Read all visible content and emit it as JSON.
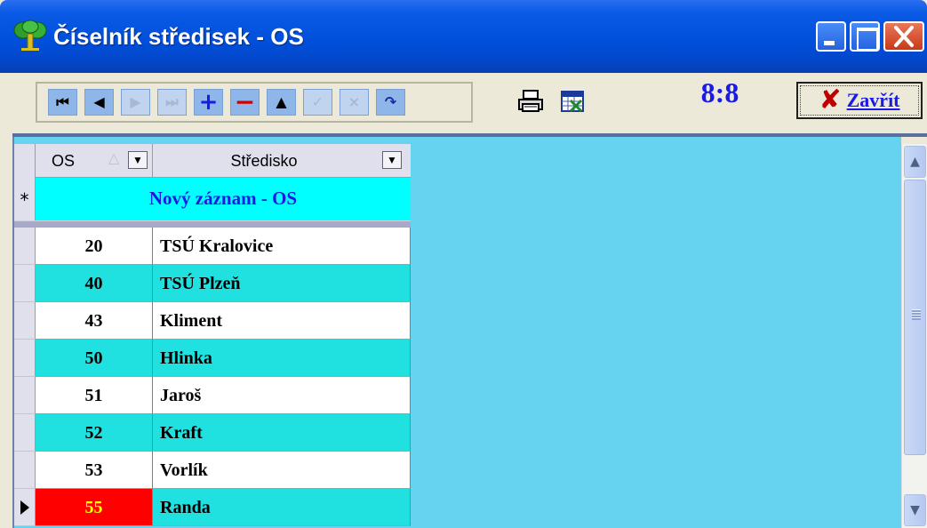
{
  "window": {
    "title": "Číselník středisek - OS",
    "accent_color": "#0050dc",
    "title_icon": "tree-icon"
  },
  "toolbar": {
    "nav_buttons": [
      {
        "name": "first-record",
        "glyph": "⏮",
        "enabled": true
      },
      {
        "name": "previous-record",
        "glyph": "◀",
        "enabled": true
      },
      {
        "name": "next-record",
        "glyph": "▶",
        "enabled": false
      },
      {
        "name": "last-record",
        "glyph": "⏭",
        "enabled": false
      },
      {
        "name": "add-record",
        "glyph": "+",
        "enabled": true
      },
      {
        "name": "delete-record",
        "glyph": "−",
        "enabled": true
      },
      {
        "name": "edit-record",
        "glyph": "▲",
        "enabled": true
      },
      {
        "name": "confirm-record",
        "glyph": "✓",
        "enabled": false
      },
      {
        "name": "cancel-record",
        "glyph": "×",
        "enabled": false
      },
      {
        "name": "refresh-record",
        "glyph": "↷",
        "enabled": true
      }
    ],
    "print_icon": "printer-icon",
    "export_icon": "calendar-excel-icon",
    "counter": "8:8",
    "close_label": "Zavřít"
  },
  "grid": {
    "columns": [
      {
        "label": "OS",
        "sorted": "ascending"
      },
      {
        "label": "Středisko"
      }
    ],
    "new_row_label": "Nový záznam - OS",
    "new_row_marker": "*",
    "rows": [
      {
        "os": "20",
        "stredisko": "TSÚ Kralovice",
        "style": "white"
      },
      {
        "os": "40",
        "stredisko": "TSÚ Plzeň",
        "style": "cyan"
      },
      {
        "os": "43",
        "stredisko": "Kliment",
        "style": "white"
      },
      {
        "os": "50",
        "stredisko": "Hlinka",
        "style": "cyan"
      },
      {
        "os": "51",
        "stredisko": "Jaroš",
        "style": "white"
      },
      {
        "os": "52",
        "stredisko": "Kraft",
        "style": "cyan"
      },
      {
        "os": "53",
        "stredisko": "Vorlík",
        "style": "white"
      },
      {
        "os": "55",
        "stredisko": "Randa",
        "style": "current"
      }
    ],
    "colors": {
      "background": "#66d4f0",
      "row_alt": "#20e0e0",
      "current_cell": "#ff0000",
      "current_text": "#ffff00",
      "new_row": "#00ffff"
    }
  }
}
